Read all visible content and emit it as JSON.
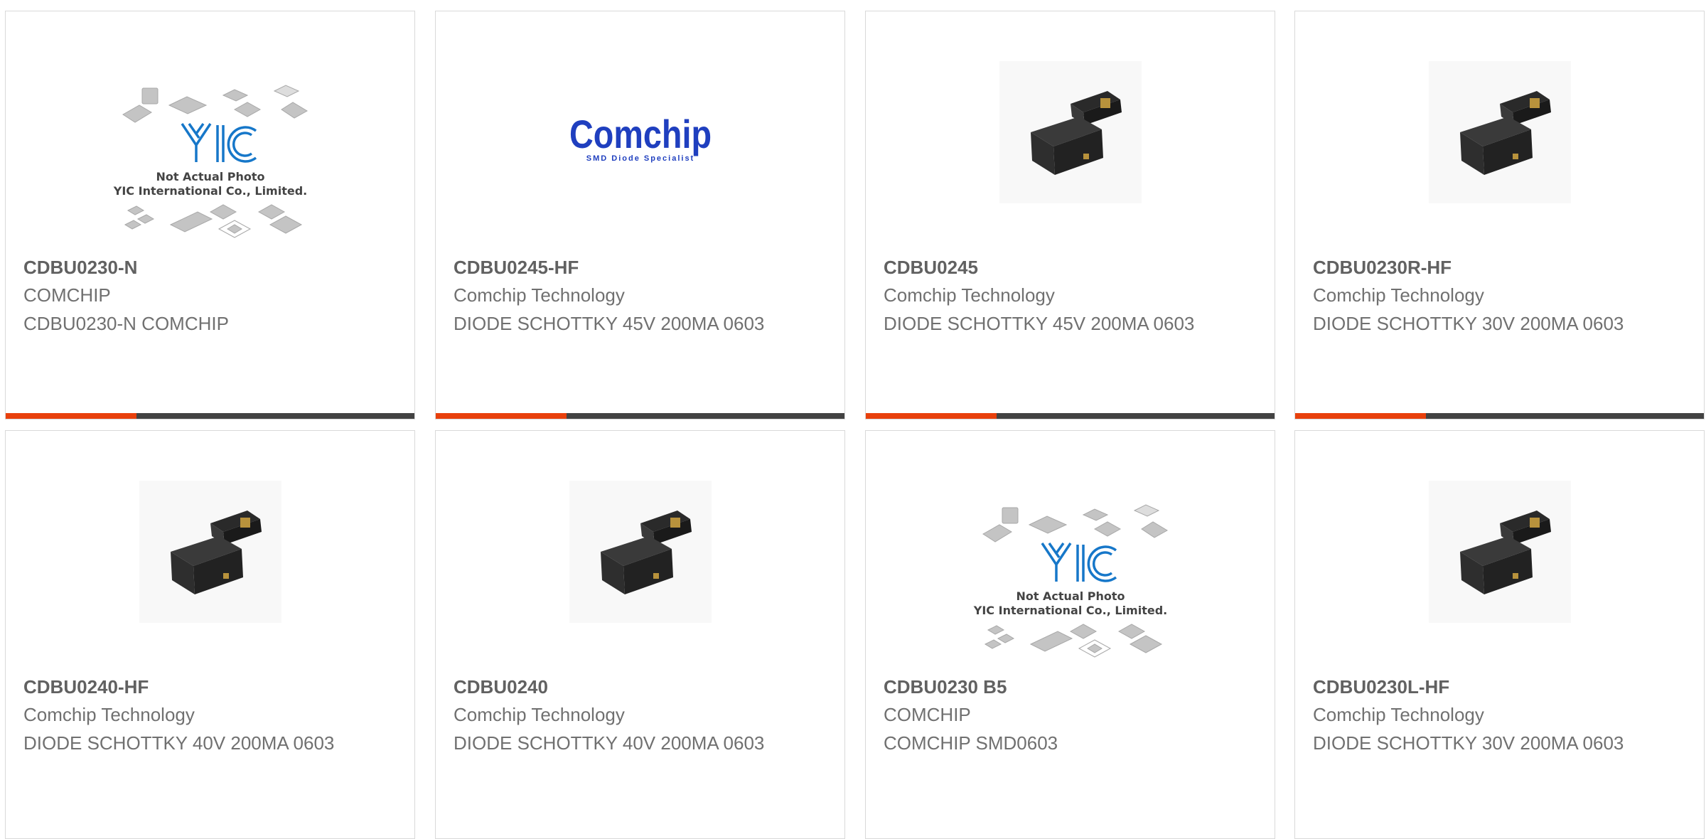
{
  "accent_color": "#e8400c",
  "bar_track_color": "#424242",
  "products": [
    {
      "sku": "CDBU0230-N",
      "manufacturer": "COMCHIP",
      "description": "CDBU0230-N COMCHIP",
      "image": "yic-placeholder",
      "placeholder_lines": [
        "Not Actual Photo",
        "YIC International Co., Limited."
      ],
      "progress": 0.32
    },
    {
      "sku": "CDBU0245-HF",
      "manufacturer": "Comchip Technology",
      "description": "DIODE SCHOTTKY 45V 200MA 0603",
      "image": "comchip-logo",
      "logo_text": "Comchip",
      "logo_tagline": "SMD Diode Specialist",
      "progress": 0.32
    },
    {
      "sku": "CDBU0245",
      "manufacturer": "Comchip Technology",
      "description": "DIODE SCHOTTKY 45V 200MA 0603",
      "image": "diode-photo",
      "progress": 0.32
    },
    {
      "sku": "CDBU0230R-HF",
      "manufacturer": "Comchip Technology",
      "description": "DIODE SCHOTTKY 30V 200MA 0603",
      "image": "diode-photo",
      "progress": 0.32
    },
    {
      "sku": "CDBU0240-HF",
      "manufacturer": "Comchip Technology",
      "description": "DIODE SCHOTTKY 40V 200MA 0603",
      "image": "diode-photo"
    },
    {
      "sku": "CDBU0240",
      "manufacturer": "Comchip Technology",
      "description": "DIODE SCHOTTKY 40V 200MA 0603",
      "image": "diode-photo"
    },
    {
      "sku": "CDBU0230 B5",
      "manufacturer": "COMCHIP",
      "description": "COMCHIP SMD0603",
      "image": "yic-placeholder",
      "placeholder_lines": [
        "Not Actual Photo",
        "YIC International Co., Limited."
      ]
    },
    {
      "sku": "CDBU0230L-HF",
      "manufacturer": "Comchip Technology",
      "description": "DIODE SCHOTTKY 30V 200MA 0603",
      "image": "diode-photo"
    }
  ]
}
